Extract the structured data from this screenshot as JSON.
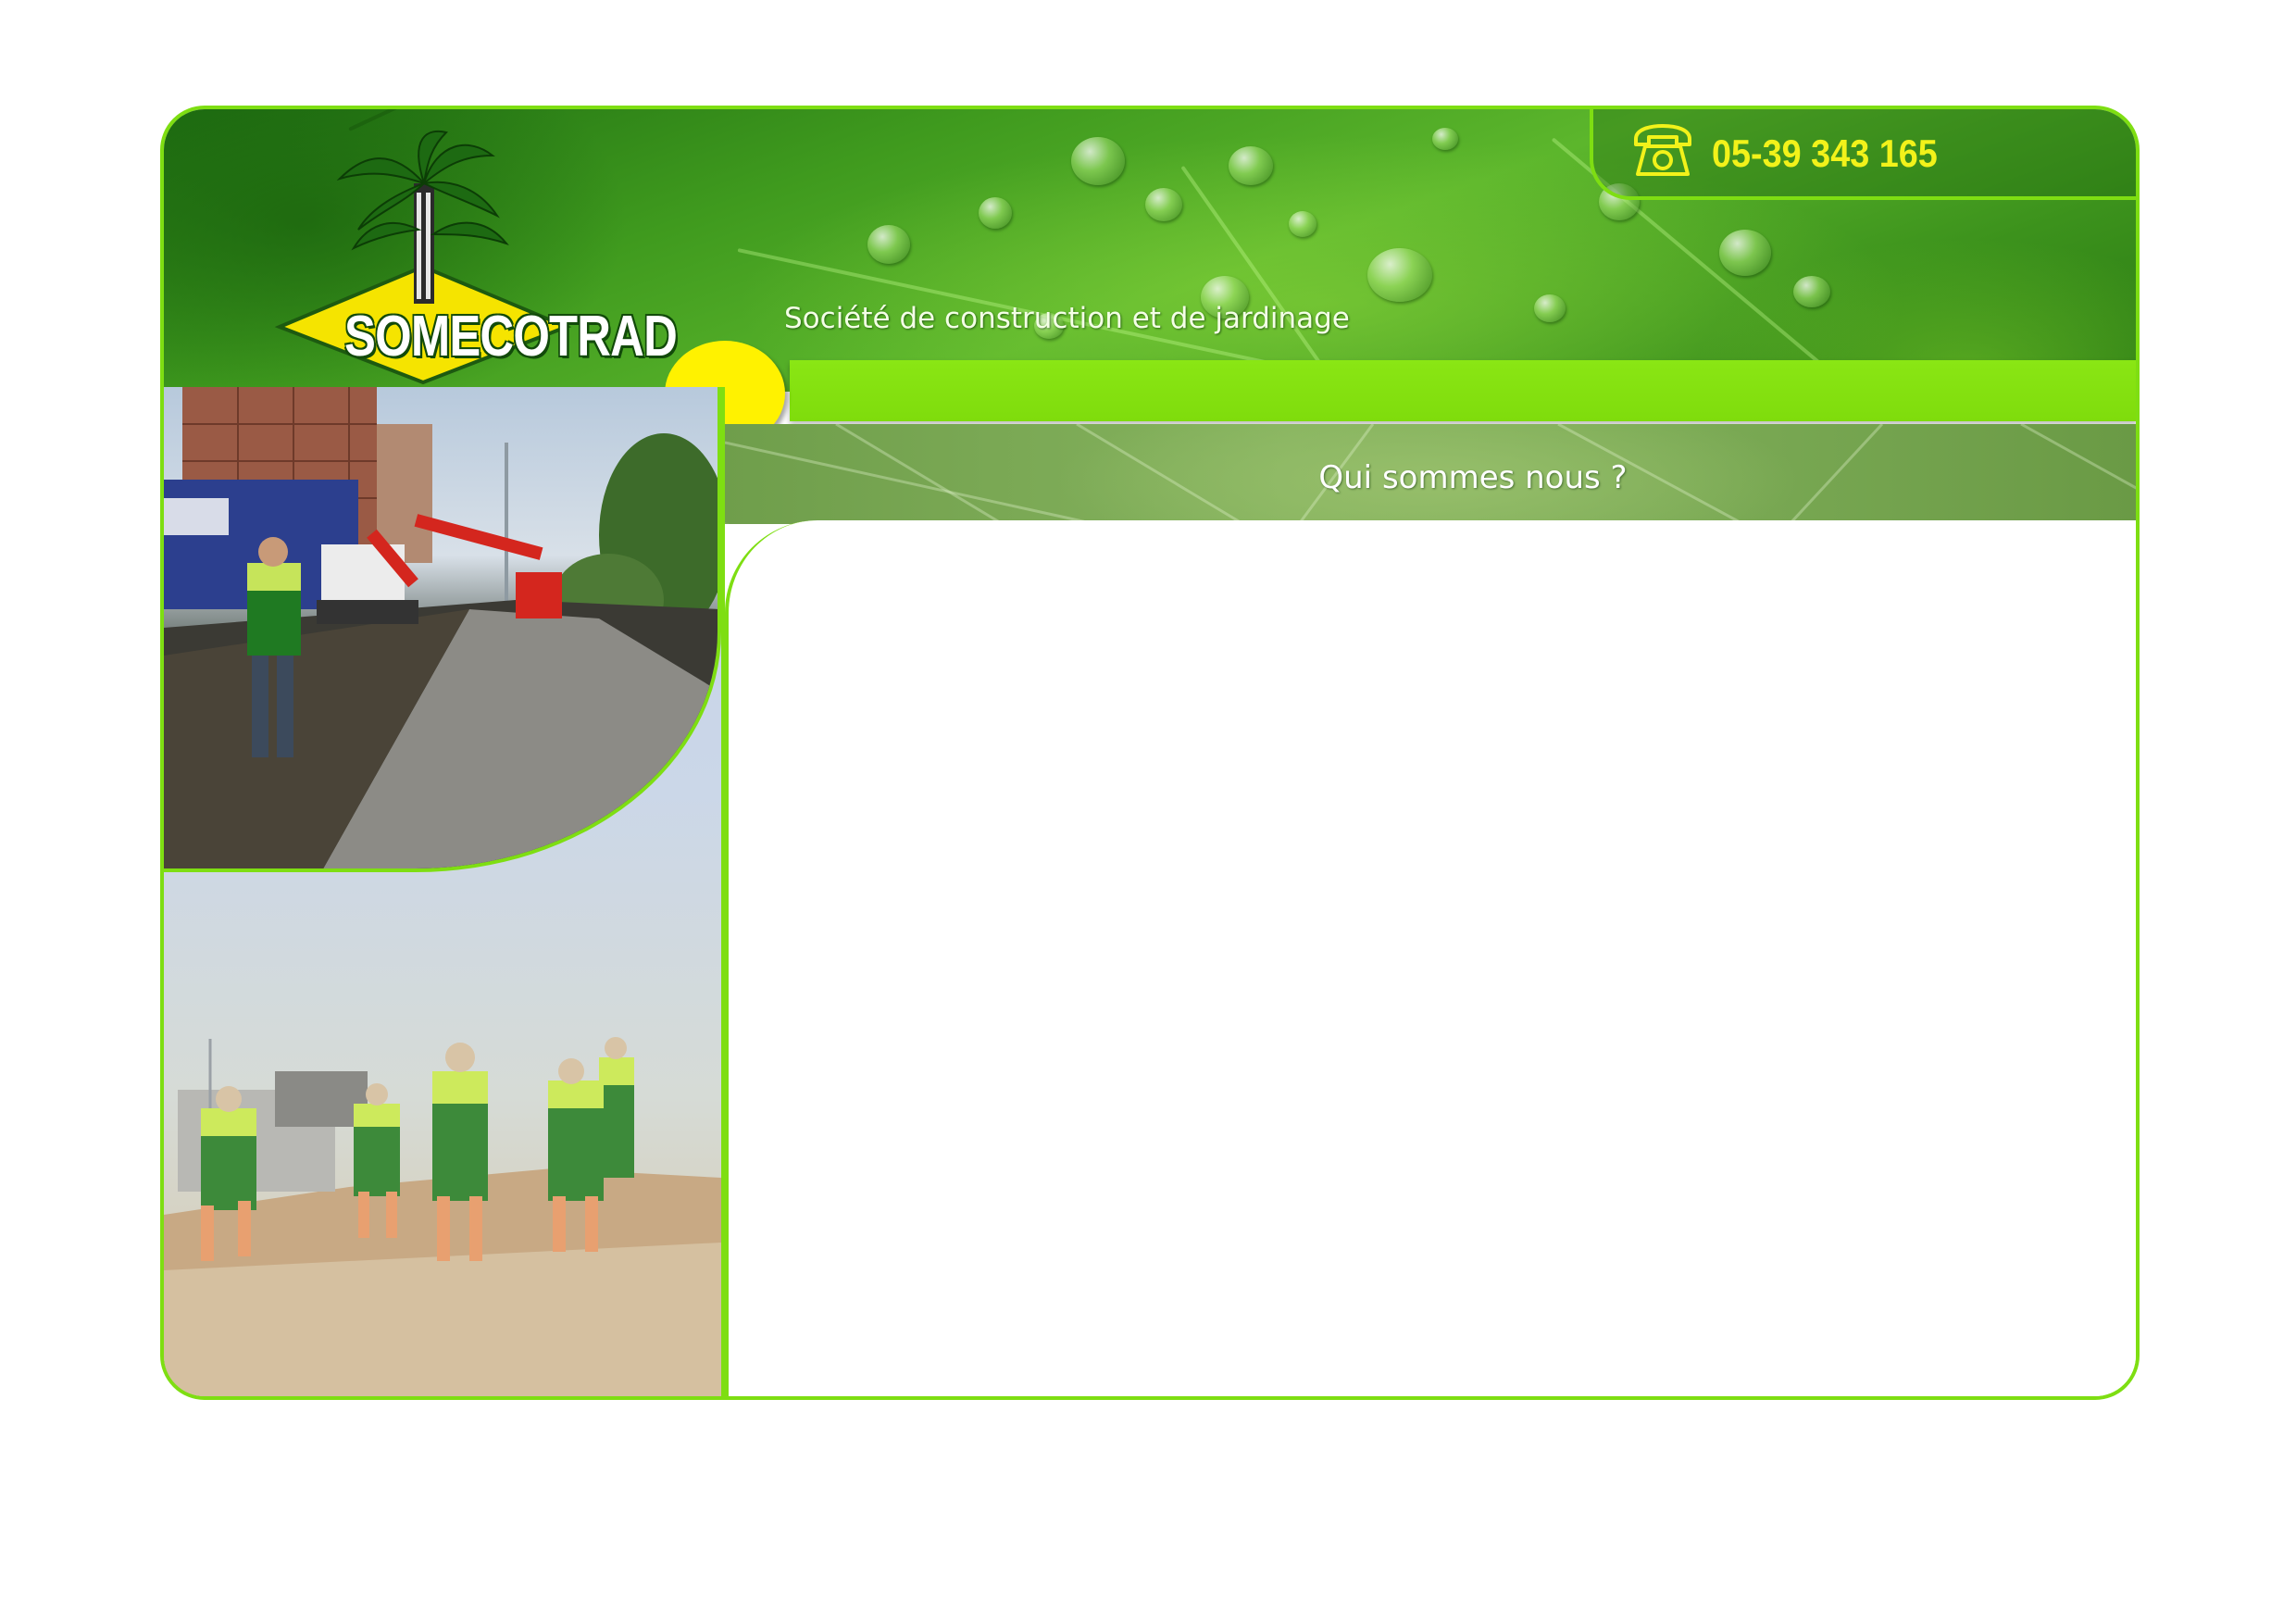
{
  "brand": {
    "name": "SOMECOTRAD",
    "tagline": "Société de construction et de jardinage"
  },
  "contact": {
    "phone_icon": "telephone-icon",
    "phone": "05-39 343 165"
  },
  "section": {
    "title": "Qui sommes nous ?"
  },
  "colors": {
    "accent_green": "#7ede12",
    "accent_yellow": "#fff200",
    "phone_text": "#f2f21a"
  },
  "images": {
    "top_photo": "road-construction-photo",
    "bottom_photo": "gardening-workers-photo"
  }
}
